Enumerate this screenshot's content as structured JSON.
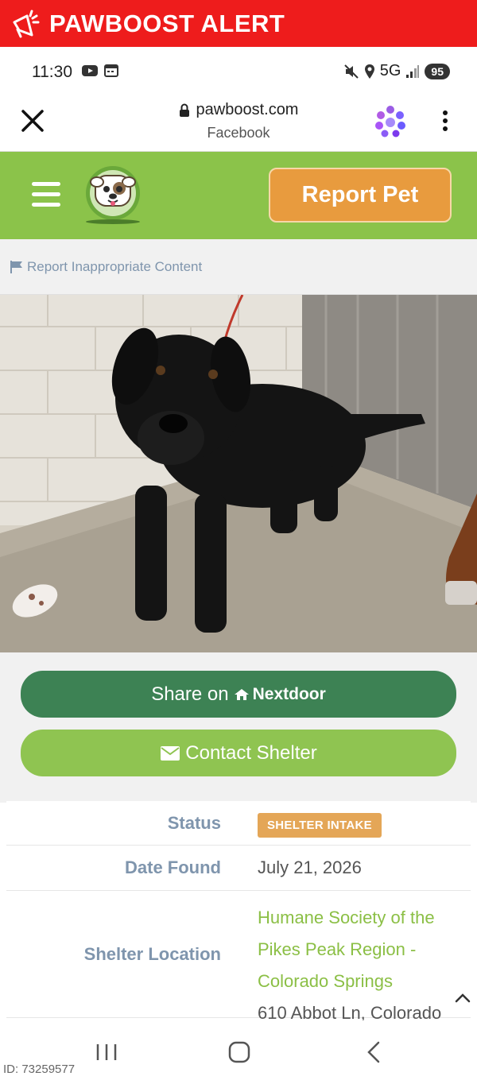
{
  "alert_bar": {
    "title": "PAWBOOST ALERT",
    "color": "#ee1c1c"
  },
  "status_bar": {
    "time": "11:30",
    "network": "5G",
    "battery": "95"
  },
  "browser": {
    "url": "pawboost.com",
    "source": "Facebook"
  },
  "header": {
    "report_button": "Report Pet",
    "color": "#8bc34a"
  },
  "report_link": "Report Inappropriate Content",
  "actions": {
    "share_prefix": "Share on",
    "share_brand": "Nextdoor",
    "contact_label": "Contact Shelter"
  },
  "info": {
    "status_label": "Status",
    "status_value": "SHELTER INTAKE",
    "date_label": "Date Found",
    "date_value": "July 21, 2026",
    "shelter_label": "Shelter Location",
    "shelter_name": "Humane Society of the Pikes Peak Region - Colorado Springs",
    "shelter_address": "610 Abbot Ln, Colorado"
  },
  "listing_id": "ID: 73259577",
  "colors": {
    "accent_orange": "#e89b3e",
    "nextdoor_green": "#3d8254",
    "contact_green": "#8fc451",
    "label_blue": "#7f95ad"
  }
}
